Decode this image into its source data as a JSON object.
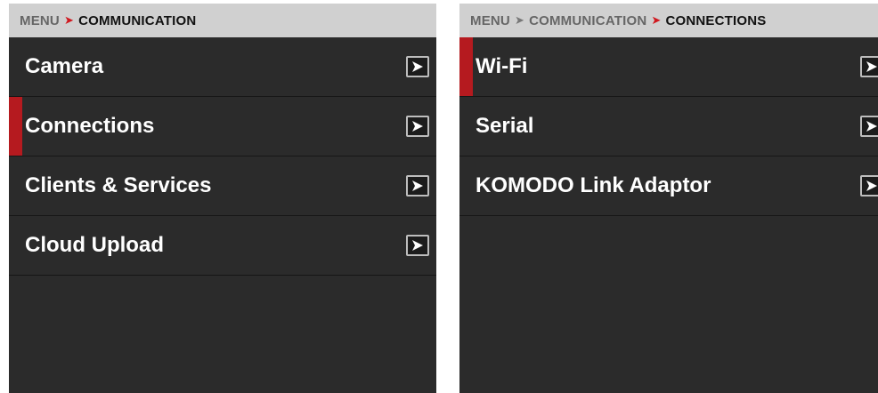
{
  "left_panel": {
    "breadcrumb": [
      {
        "label": "MENU",
        "current": false
      },
      {
        "label": "COMMUNICATION",
        "current": true
      }
    ],
    "items": [
      {
        "label": "Camera",
        "selected": false
      },
      {
        "label": "Connections",
        "selected": true
      },
      {
        "label": "Clients & Services",
        "selected": false
      },
      {
        "label": "Cloud Upload",
        "selected": false
      }
    ]
  },
  "right_panel": {
    "breadcrumb": [
      {
        "label": "MENU",
        "current": false
      },
      {
        "label": "COMMUNICATION",
        "current": false
      },
      {
        "label": "CONNECTIONS",
        "current": true
      }
    ],
    "items": [
      {
        "label": "Wi-Fi",
        "selected": true
      },
      {
        "label": "Serial",
        "selected": false
      },
      {
        "label": "KOMODO Link Adaptor",
        "selected": false
      }
    ]
  },
  "colors": {
    "accent_red": "#d0181f",
    "panel_bg": "#2b2b2b",
    "header_bg": "#d0d0d0"
  },
  "icons": {
    "breadcrumb_separator": "chevron-right-icon",
    "row_arrow": "arrow-right-icon"
  }
}
